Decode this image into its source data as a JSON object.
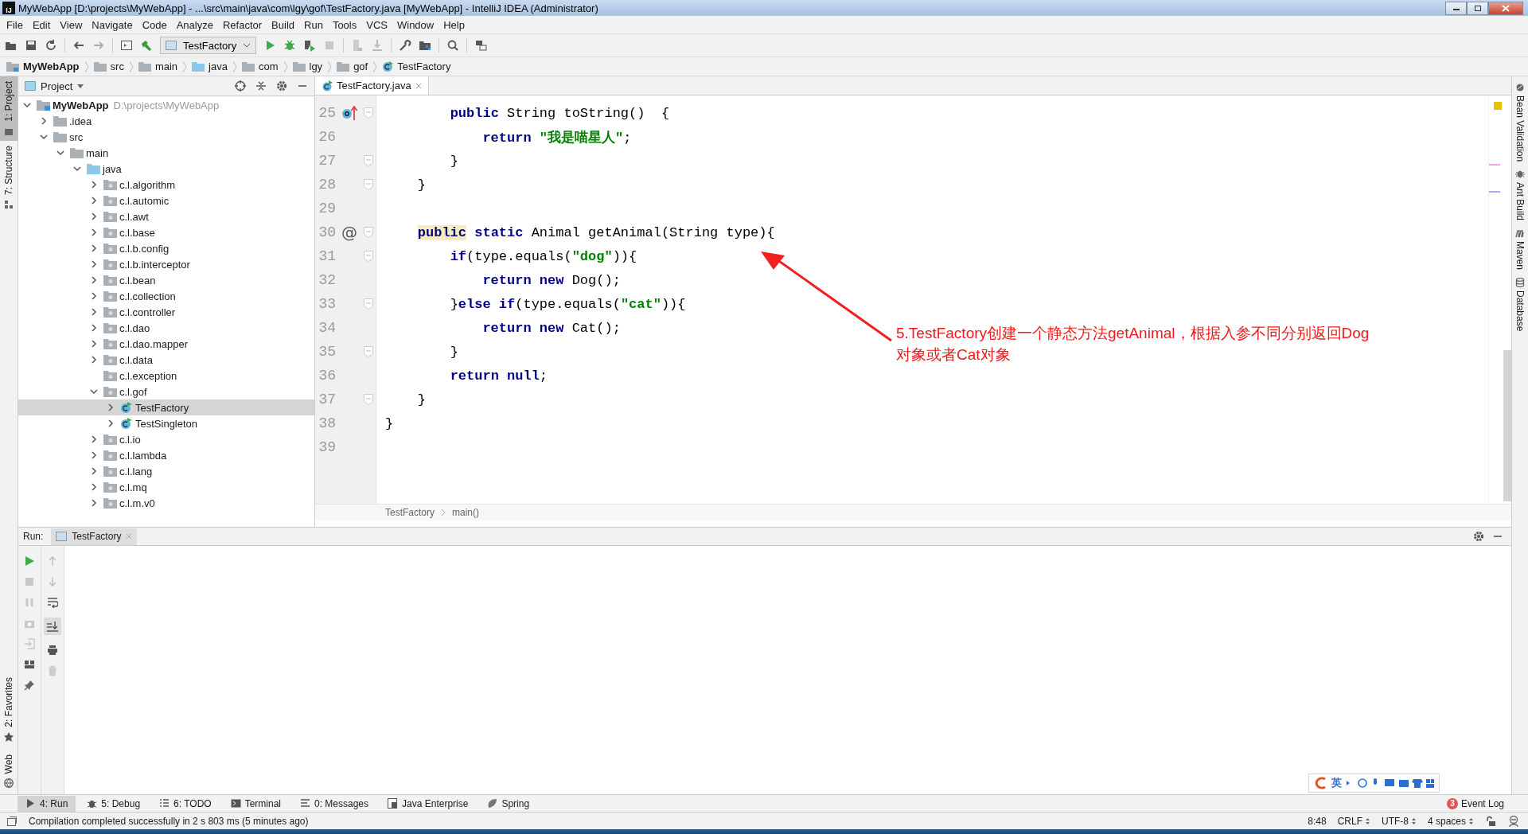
{
  "window": {
    "logo": "IJ",
    "title": "MyWebApp [D:\\projects\\MyWebApp] - ...\\src\\main\\java\\com\\lgy\\gof\\TestFactory.java [MyWebApp] - IntelliJ IDEA (Administrator)"
  },
  "menu": [
    "File",
    "Edit",
    "View",
    "Navigate",
    "Code",
    "Analyze",
    "Refactor",
    "Build",
    "Run",
    "Tools",
    "VCS",
    "Window",
    "Help"
  ],
  "toolbar": {
    "run_config": "TestFactory"
  },
  "nav_bar": [
    {
      "label": "MyWebApp",
      "kind": "module"
    },
    {
      "label": "src",
      "kind": "folder"
    },
    {
      "label": "main",
      "kind": "folder"
    },
    {
      "label": "java",
      "kind": "source"
    },
    {
      "label": "com",
      "kind": "package"
    },
    {
      "label": "lgy",
      "kind": "package"
    },
    {
      "label": "gof",
      "kind": "package"
    },
    {
      "label": "TestFactory",
      "kind": "class"
    }
  ],
  "left_stripe": [
    {
      "label": "1: Project",
      "selected": true
    },
    {
      "label": "7: Structure",
      "selected": false
    }
  ],
  "left_stripe_bottom": [
    {
      "label": "2: Favorites",
      "selected": false
    },
    {
      "label": "Web",
      "selected": false
    }
  ],
  "project_panel": {
    "title": "Project",
    "tree": [
      {
        "label": "MyWebApp",
        "path": "D:\\projects\\MyWebApp",
        "kind": "module",
        "expanded": true,
        "selected": false,
        "children": [
          {
            "label": ".idea",
            "kind": "folder",
            "expanded": false,
            "selected": false
          },
          {
            "label": "src",
            "kind": "folder",
            "expanded": true,
            "selected": false,
            "children": [
              {
                "label": "main",
                "kind": "folder",
                "expanded": true,
                "selected": false,
                "children": [
                  {
                    "label": "java",
                    "kind": "source",
                    "expanded": true,
                    "selected": false,
                    "children": [
                      {
                        "label": "c.l.algorithm",
                        "kind": "package",
                        "expanded": false,
                        "selected": false
                      },
                      {
                        "label": "c.l.automic",
                        "kind": "package",
                        "expanded": false,
                        "selected": false
                      },
                      {
                        "label": "c.l.awt",
                        "kind": "package",
                        "expanded": false,
                        "selected": false
                      },
                      {
                        "label": "c.l.base",
                        "kind": "package",
                        "expanded": false,
                        "selected": false
                      },
                      {
                        "label": "c.l.b.config",
                        "kind": "package",
                        "expanded": false,
                        "selected": false
                      },
                      {
                        "label": "c.l.b.interceptor",
                        "kind": "package",
                        "expanded": false,
                        "selected": false
                      },
                      {
                        "label": "c.l.bean",
                        "kind": "package",
                        "expanded": false,
                        "selected": false
                      },
                      {
                        "label": "c.l.collection",
                        "kind": "package",
                        "expanded": false,
                        "selected": false
                      },
                      {
                        "label": "c.l.controller",
                        "kind": "package",
                        "expanded": false,
                        "selected": false
                      },
                      {
                        "label": "c.l.dao",
                        "kind": "package",
                        "expanded": false,
                        "selected": false
                      },
                      {
                        "label": "c.l.dao.mapper",
                        "kind": "package",
                        "expanded": false,
                        "selected": false
                      },
                      {
                        "label": "c.l.data",
                        "kind": "package",
                        "expanded": false,
                        "selected": false
                      },
                      {
                        "label": "c.l.exception",
                        "kind": "package",
                        "selected": false
                      },
                      {
                        "label": "c.l.gof",
                        "kind": "package",
                        "expanded": true,
                        "selected": false,
                        "children": [
                          {
                            "label": "TestFactory",
                            "kind": "class",
                            "expanded": false,
                            "selected": true
                          },
                          {
                            "label": "TestSingleton",
                            "kind": "class",
                            "expanded": false,
                            "selected": false
                          }
                        ]
                      },
                      {
                        "label": "c.l.io",
                        "kind": "package",
                        "expanded": false,
                        "selected": false
                      },
                      {
                        "label": "c.l.lambda",
                        "kind": "package",
                        "expanded": false,
                        "selected": false
                      },
                      {
                        "label": "c.l.lang",
                        "kind": "package",
                        "expanded": false,
                        "selected": false
                      },
                      {
                        "label": "c.l.mq",
                        "kind": "package",
                        "expanded": false,
                        "selected": false
                      },
                      {
                        "label": "c.l.m.v0",
                        "kind": "package",
                        "expanded": false,
                        "selected": false
                      }
                    ]
                  }
                ]
              }
            ]
          }
        ]
      }
    ]
  },
  "editor": {
    "tabs": [
      {
        "label": "TestFactory.java",
        "selected": true
      }
    ],
    "lines": [
      {
        "number": "25",
        "fold": true,
        "gutter": {
          "kind": "override"
        },
        "tokens": [
          {
            "text": "        public",
            "kind": "keyword"
          },
          {
            "text": " String toString()  {",
            "kind": "plain"
          }
        ]
      },
      {
        "number": "26",
        "fold": false,
        "tokens": [
          {
            "text": "            return",
            "kind": "keyword"
          },
          {
            "text": " \"我是喵星人\"",
            "kind": "string"
          },
          {
            "text": ";",
            "kind": "plain"
          }
        ]
      },
      {
        "number": "27",
        "fold": true,
        "tokens": [
          {
            "text": "        }",
            "kind": "plain"
          }
        ]
      },
      {
        "number": "28",
        "fold": true,
        "tokens": [
          {
            "text": "    }",
            "kind": "plain"
          }
        ]
      },
      {
        "number": "29",
        "fold": false
      },
      {
        "number": "30",
        "fold": true,
        "gutter": {
          "kind": "text",
          "text": "@"
        },
        "tokens": [
          {
            "text": "    public",
            "kind": "highlight"
          },
          {
            "text": " static",
            "kind": "keyword"
          },
          {
            "text": " Animal getAnimal(String type){",
            "kind": "plain"
          }
        ]
      },
      {
        "number": "31",
        "fold": true,
        "tokens": [
          {
            "text": "        if",
            "kind": "keyword"
          },
          {
            "text": "(type.equals(",
            "kind": "plain"
          },
          {
            "text": "\"dog\"",
            "kind": "string"
          },
          {
            "text": ")){",
            "kind": "plain"
          }
        ]
      },
      {
        "number": "32",
        "fold": false,
        "tokens": [
          {
            "text": "            return",
            "kind": "keyword"
          },
          {
            "text": " new",
            "kind": "keyword"
          },
          {
            "text": " Dog();",
            "kind": "plain"
          }
        ]
      },
      {
        "number": "33",
        "fold": true,
        "tokens": [
          {
            "text": "        }",
            "kind": "plain"
          },
          {
            "text": "else",
            "kind": "keyword"
          },
          {
            "text": " if",
            "kind": "keyword"
          },
          {
            "text": "(type.equals(",
            "kind": "plain"
          },
          {
            "text": "\"cat\"",
            "kind": "string"
          },
          {
            "text": ")){",
            "kind": "plain"
          }
        ]
      },
      {
        "number": "34",
        "fold": false,
        "tokens": [
          {
            "text": "            return",
            "kind": "keyword"
          },
          {
            "text": " new",
            "kind": "keyword"
          },
          {
            "text": " Cat();",
            "kind": "plain"
          }
        ]
      },
      {
        "number": "35",
        "fold": true,
        "tokens": [
          {
            "text": "        }",
            "kind": "plain"
          }
        ]
      },
      {
        "number": "36",
        "fold": false,
        "tokens": [
          {
            "text": "        return",
            "kind": "keyword"
          },
          {
            "text": " null",
            "kind": "keyword"
          },
          {
            "text": ";",
            "kind": "plain"
          }
        ]
      },
      {
        "number": "37",
        "fold": true,
        "tokens": [
          {
            "text": "    }",
            "kind": "plain"
          }
        ]
      },
      {
        "number": "38",
        "fold": false,
        "tokens": [
          {
            "text": "}",
            "kind": "plain"
          }
        ]
      },
      {
        "number": "39",
        "fold": false
      }
    ],
    "breadcrumb": [
      "TestFactory",
      "main()"
    ]
  },
  "annotation": {
    "text": "5.TestFactory创建一个静态方法getAnimal，根据入参不同分别返回Dog对象或者Cat对象"
  },
  "right_stripe": [
    {
      "label": "Bean Validation",
      "kind": "bean"
    },
    {
      "label": "Ant Build",
      "kind": "ant"
    },
    {
      "label": "Maven",
      "kind": "maven"
    },
    {
      "label": "Database",
      "kind": "database"
    }
  ],
  "run_panel": {
    "label": "Run:",
    "tabs": [
      {
        "label": "TestFactory",
        "selected": true
      }
    ]
  },
  "ime_toolbar": {
    "label": "英"
  },
  "tool_tabs": [
    {
      "label": "4: Run",
      "kind": "run",
      "selected": true
    },
    {
      "label": "5: Debug",
      "kind": "debug",
      "selected": false
    },
    {
      "label": "6: TODO",
      "kind": "todo",
      "selected": false
    },
    {
      "label": "Terminal",
      "kind": "terminal",
      "selected": false
    },
    {
      "label": "0: Messages",
      "kind": "messages",
      "selected": false
    },
    {
      "label": "Java Enterprise",
      "kind": "javaee",
      "selected": false
    },
    {
      "label": "Spring",
      "kind": "spring",
      "selected": false
    }
  ],
  "event_log": {
    "label": "Event Log",
    "count": "3"
  },
  "status_bar": {
    "message": "Compilation completed successfully in 2 s 803 ms (5 minutes ago)",
    "position": "8:48",
    "line_separator": "CRLF",
    "encoding": "UTF-8",
    "indent": "4 spaces"
  }
}
